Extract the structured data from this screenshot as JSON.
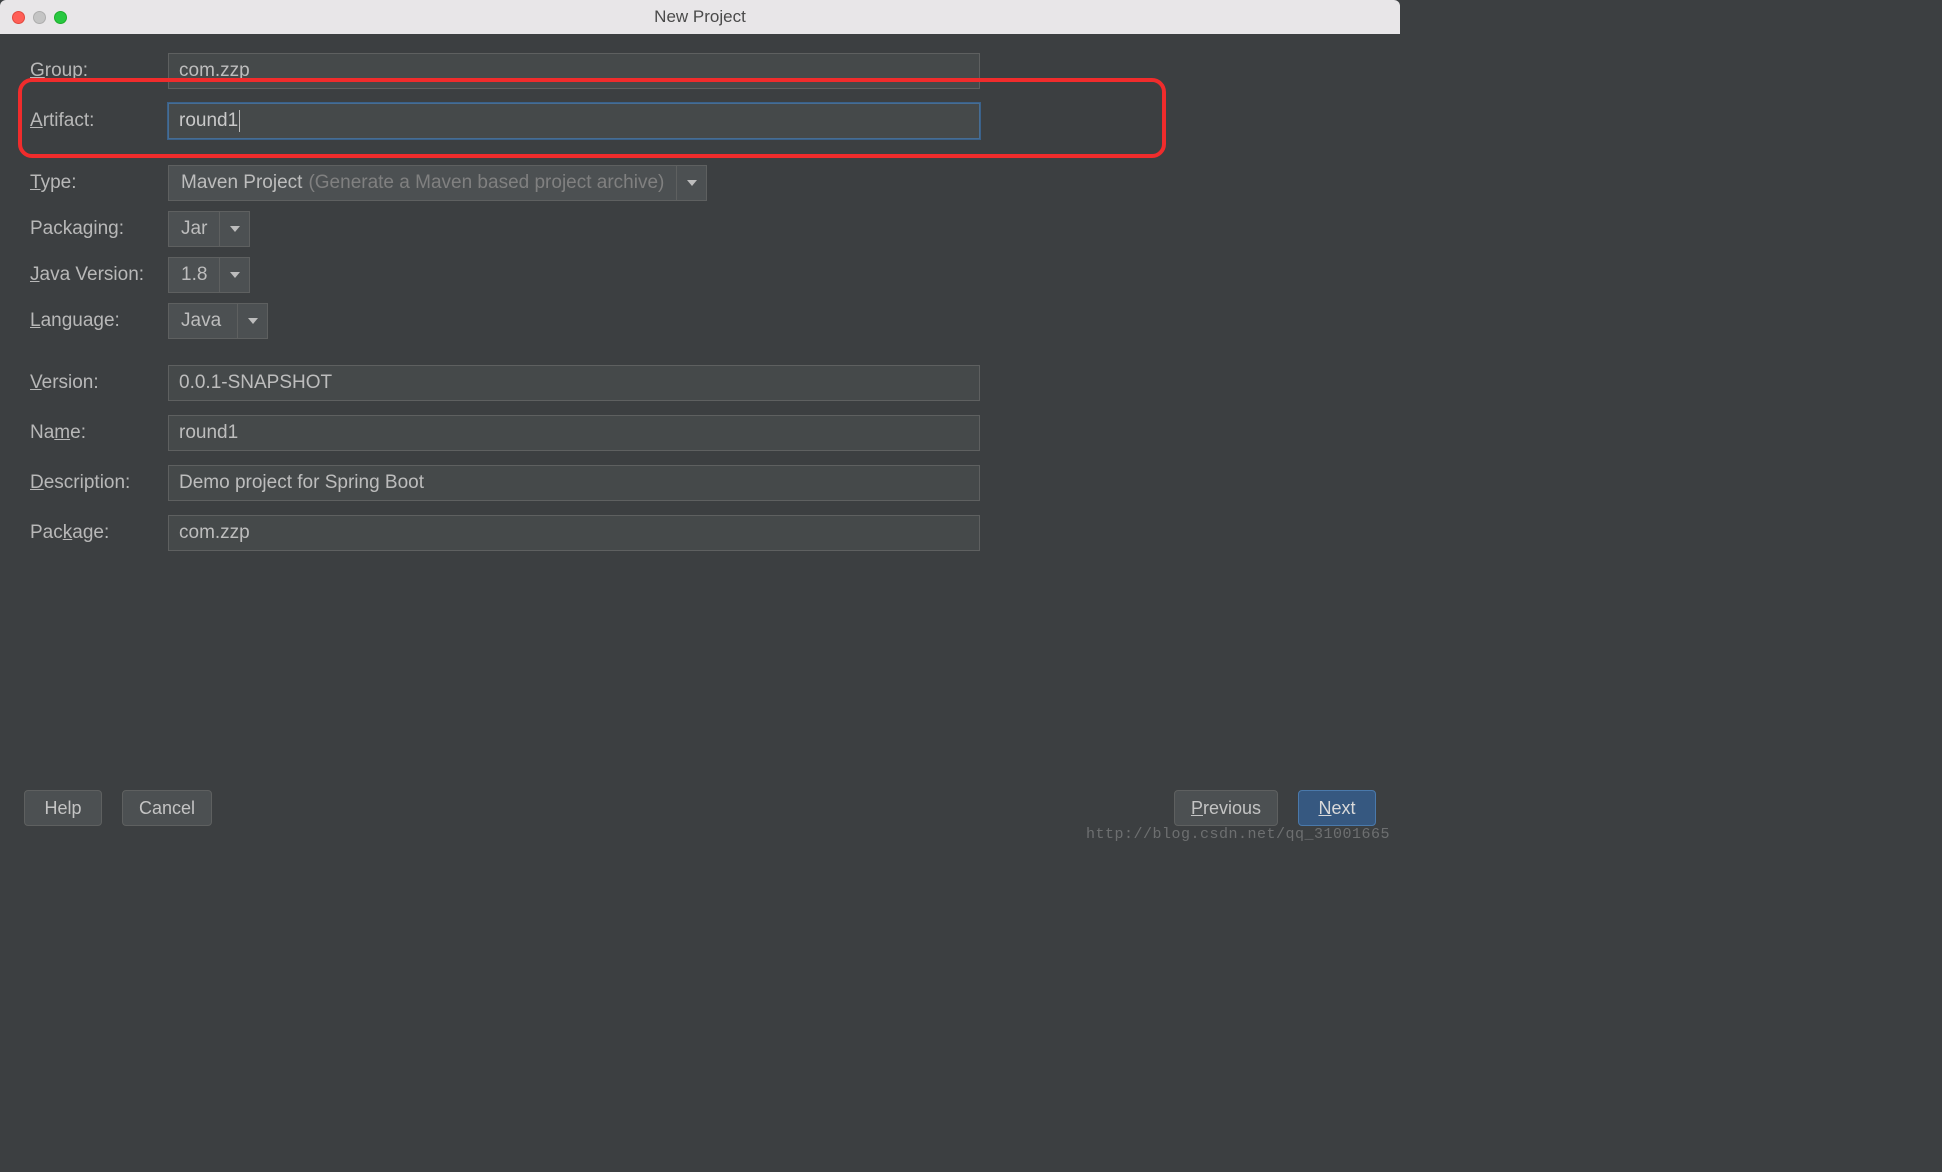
{
  "window": {
    "title": "New Project"
  },
  "labels": {
    "group": "roup:",
    "artifact": "rtifact:",
    "type": "ype:",
    "packaging": "Packaging:",
    "javaVersion": "ava Version:",
    "language": "anguage:",
    "version": "ersion:",
    "name": "Na",
    "name2": "e:",
    "description": "escription:",
    "package": "Pac",
    "package2": "age:"
  },
  "mnemonics": {
    "group": "G",
    "artifact": "A",
    "type": "T",
    "javaVersion": "J",
    "language": "L",
    "version": "V",
    "name": "m",
    "description": "D",
    "package": "k"
  },
  "values": {
    "group": "com.zzp",
    "artifact": "round1",
    "typeMain": "Maven Project",
    "typeHint": "(Generate a Maven based project archive)",
    "packaging": "Jar",
    "javaVersion": "1.8",
    "language": "Java",
    "version": "0.0.1-SNAPSHOT",
    "name": "round1",
    "description": "Demo project for Spring Boot",
    "package": "com.zzp"
  },
  "buttons": {
    "help": "Help",
    "cancel": "Cancel",
    "previous": "revious",
    "next": "ext"
  },
  "buttonMnemonics": {
    "previous": "P",
    "next": "N"
  },
  "watermark": "http://blog.csdn.net/qq_31001665"
}
